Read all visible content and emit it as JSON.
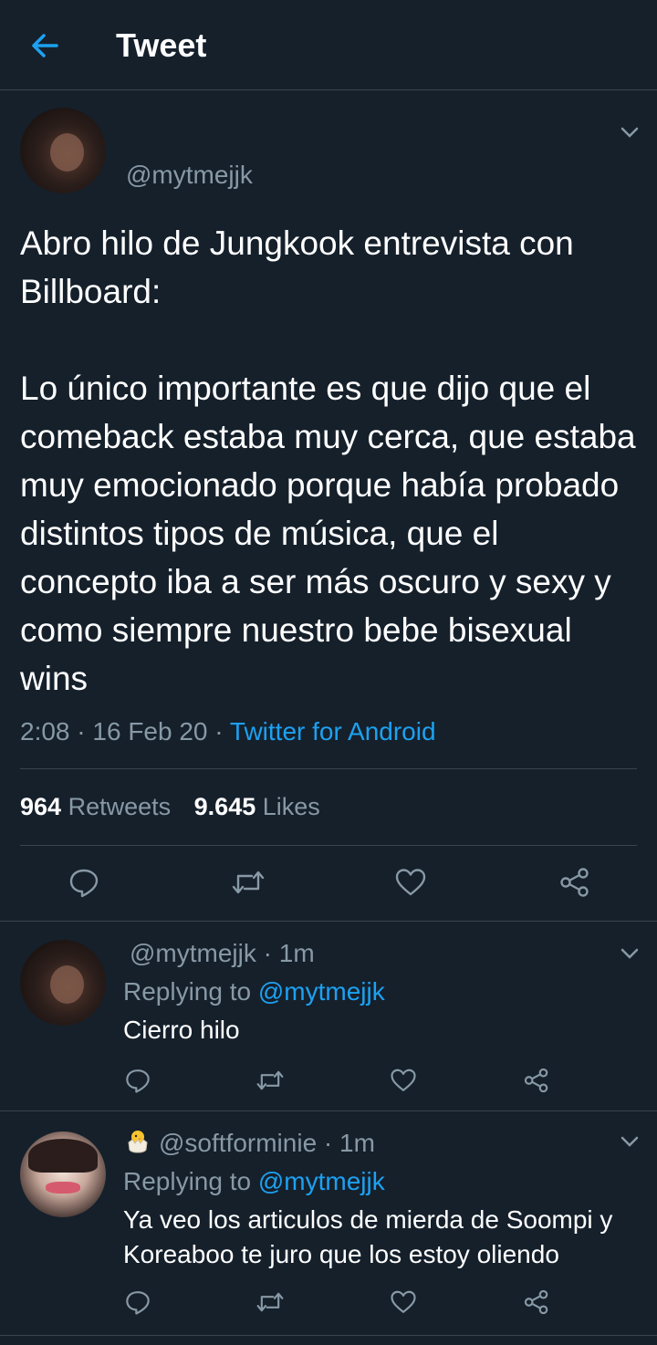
{
  "header": {
    "title": "Tweet"
  },
  "main_tweet": {
    "handle": "@mytmejjk",
    "text": "Abro hilo de Jungkook entrevista con Billboard:\n\nLo único importante es que dijo que el comeback estaba muy cerca, que estaba muy emocionado porque había probado distintos tipos de música, que el concepto iba a ser más oscuro y sexy y como siempre nuestro bebe bisexual wins",
    "time": "2:08",
    "date": "16 Feb 20",
    "source": "Twitter for Android",
    "retweets_count": "964",
    "retweets_label": "Retweets",
    "likes_count": "9.645",
    "likes_label": "Likes"
  },
  "replies": [
    {
      "handle": "@mytmejjk",
      "time": "1m",
      "replying_label": "Replying to",
      "replying_to": "@mytmejjk",
      "text": "Cierro hilo"
    },
    {
      "handle": "@softforminie",
      "time": "1m",
      "replying_label": "Replying to",
      "replying_to": "@mytmejjk",
      "text": "Ya veo los articulos de mierda de Soompi y Koreaboo te juro que los estoy oliendo"
    }
  ],
  "colors": {
    "background": "#15202b",
    "accent": "#1da1f2",
    "muted": "#8899a6",
    "divider": "#38444d"
  }
}
